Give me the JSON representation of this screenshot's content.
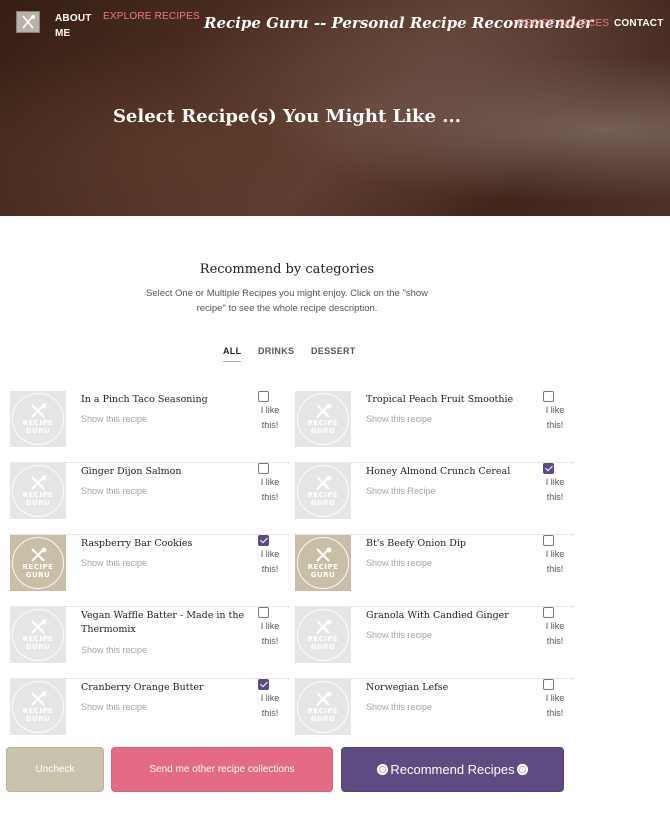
{
  "nav": {
    "about": "About Me",
    "explore": "Explore Recipes",
    "site_title": "Recipe Guru -- Personal Recipe Recommender",
    "sources": "Recipe Sources",
    "contact": "Contact"
  },
  "hero": {
    "heading": "Select Recipe(s) You Might Like ..."
  },
  "section": {
    "title": "Recommend by categories",
    "description": "Select One or Multiple Recipes you might enjoy. Click on the \"show recipe\" to see the whole recipe description."
  },
  "tabs": [
    "ALL",
    "DRINKS",
    "DESSERT"
  ],
  "thumbnail_brand": "RECIPE GURU",
  "recipes": [
    {
      "title": "In a Pinch Taco Seasoning",
      "link": "Show this recipe",
      "checked": false,
      "like": "I like this!"
    },
    {
      "title": "Tropical Peach Fruit Smoothie",
      "link": "Show this recipe",
      "checked": false,
      "like": "I like this!"
    },
    {
      "title": "Ginger Dijon Salmon",
      "link": "Show this recipe",
      "checked": false,
      "like": "I like this!"
    },
    {
      "title": "Honey Almond Crunch Cereal",
      "link": "Show this Recipe",
      "checked": true,
      "like": "I like this!"
    },
    {
      "title": "Raspberry Bar Cookies",
      "link": "Show this recipe",
      "checked": true,
      "like": "I like this!"
    },
    {
      "title": "Bt's Beefy Onion Dip",
      "link": "Show this recipe",
      "checked": false,
      "like": "I like this!"
    },
    {
      "title": "Vegan Waffle Batter - Made in the Thermomix",
      "link": "Show this recipe",
      "checked": false,
      "like": "I like this!"
    },
    {
      "title": "Granola With Candied Ginger",
      "link": "Show this recipe",
      "checked": false,
      "like": "I like this!"
    },
    {
      "title": "Cranberry Orange Butter",
      "link": "Show this recipe",
      "checked": true,
      "like": "I like this!"
    },
    {
      "title": "Norwegian Lefse",
      "link": "Show this recipe",
      "checked": false,
      "like": "I like this!"
    }
  ],
  "buttons": {
    "uncheck": "Uncheck",
    "send": "Send me other recipe collections",
    "recommend": "Recommend Recipes"
  },
  "colors": {
    "accent_pink": "#e46a86",
    "accent_purple": "#5d4b82",
    "uncheck_tan": "#c9c2ad",
    "nav_highlight": "#ee7b86"
  }
}
